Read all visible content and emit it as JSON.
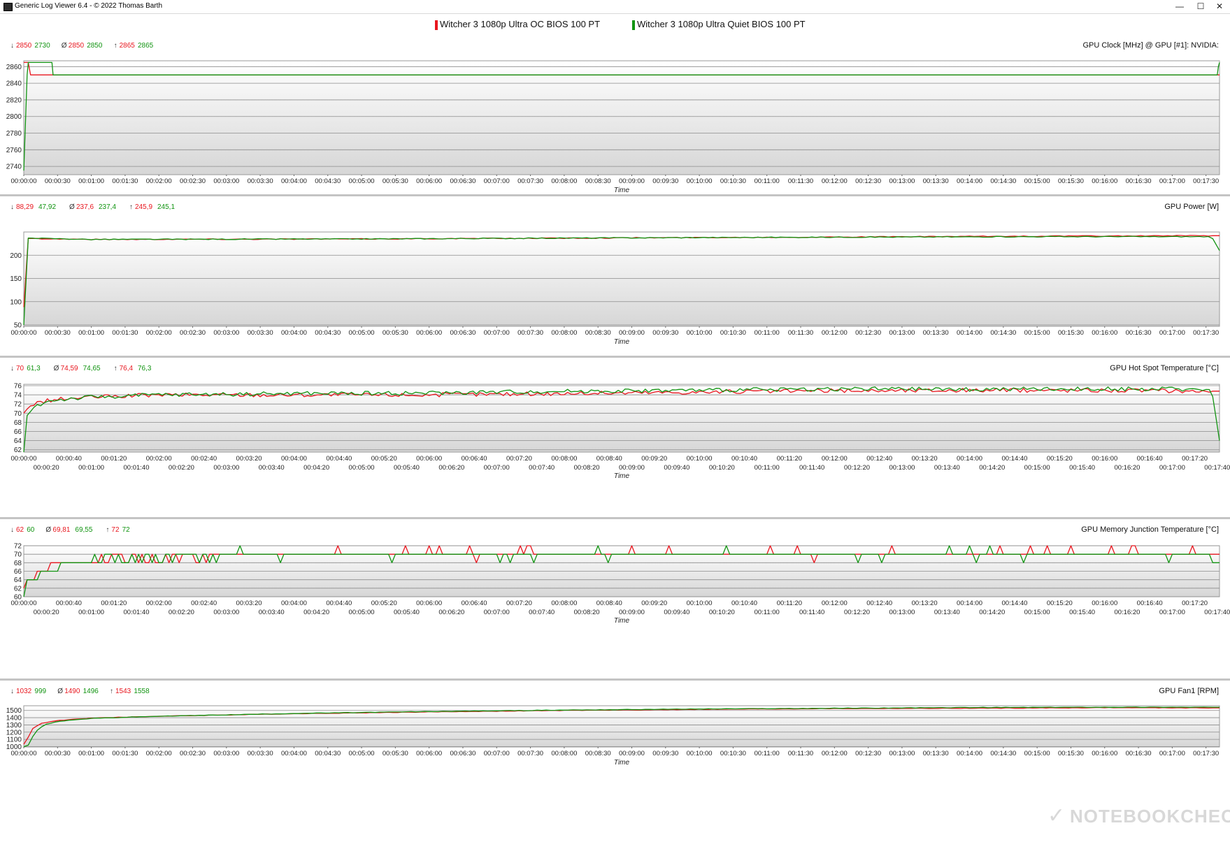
{
  "window": {
    "title": "Generic Log Viewer 6.4 - © 2022 Thomas Barth",
    "min_glyph": "—",
    "max_glyph": "☐",
    "close_glyph": "✕"
  },
  "colors": {
    "red": "#e8161e",
    "green": "#119411"
  },
  "legend": [
    {
      "label": "Witcher 3 1080p Ultra OC BIOS 100 PT",
      "color": "#e8161e"
    },
    {
      "label": "Witcher 3 1080p Ultra Quiet BIOS 100 PT",
      "color": "#119411"
    }
  ],
  "watermark": "NOTEBOOKCHECK",
  "chart_data": [
    {
      "type": "line",
      "title": "GPU Clock [MHz] @ GPU [#1]: NVIDIA:",
      "xlabel": "Time",
      "stats": {
        "min": [
          "2850",
          "2730"
        ],
        "avg": [
          "2850",
          "2850"
        ],
        "max": [
          "2865",
          "2865"
        ]
      },
      "ylim": [
        2730,
        2867
      ],
      "yticks": [
        2740,
        2760,
        2780,
        2800,
        2820,
        2840,
        2860
      ],
      "xticks_single": [
        "00:00:00",
        "00:00:30",
        "00:01:00",
        "00:01:30",
        "00:02:00",
        "00:02:30",
        "00:03:00",
        "00:03:30",
        "00:04:00",
        "00:04:30",
        "00:05:00",
        "00:05:30",
        "00:06:00",
        "00:06:30",
        "00:07:00",
        "00:07:30",
        "00:08:00",
        "00:08:30",
        "00:09:00",
        "00:09:30",
        "00:10:00",
        "00:10:30",
        "00:11:00",
        "00:11:30",
        "00:12:00",
        "00:12:30",
        "00:13:00",
        "00:13:30",
        "00:14:00",
        "00:14:30",
        "00:15:00",
        "00:15:30",
        "00:16:00",
        "00:16:30",
        "00:17:00",
        "00:17:30"
      ],
      "series": [
        {
          "name": "Witcher 3 1080p Ultra OC BIOS 100 PT",
          "x": [
            0,
            4,
            6,
            1060,
            1062,
            1062
          ],
          "y": [
            2865,
            2865,
            2850,
            2850,
            2850,
            2850
          ]
        },
        {
          "name": "Witcher 3 1080p Ultra Quiet BIOS 100 PT",
          "x": [
            0,
            3,
            4,
            25,
            26,
            1060,
            1061,
            1062
          ],
          "y": [
            2735,
            2850,
            2865,
            2865,
            2850,
            2850,
            2860,
            2865
          ]
        }
      ]
    },
    {
      "type": "line",
      "title": "GPU Power [W]",
      "xlabel": "Time",
      "stats": {
        "min": [
          "88,29",
          "47,92"
        ],
        "avg": [
          "237,6",
          "237,4"
        ],
        "max": [
          "245,9",
          "245,1"
        ]
      },
      "ylim": [
        47,
        250
      ],
      "yticks": [
        50,
        100,
        150,
        200
      ],
      "xticks_single": [
        "00:00:00",
        "00:00:30",
        "00:01:00",
        "00:01:30",
        "00:02:00",
        "00:02:30",
        "00:03:00",
        "00:03:30",
        "00:04:00",
        "00:04:30",
        "00:05:00",
        "00:05:30",
        "00:06:00",
        "00:06:30",
        "00:07:00",
        "00:07:30",
        "00:08:00",
        "00:08:30",
        "00:09:00",
        "00:09:30",
        "00:10:00",
        "00:10:30",
        "00:11:00",
        "00:11:30",
        "00:12:00",
        "00:12:30",
        "00:13:00",
        "00:13:30",
        "00:14:00",
        "00:14:30",
        "00:15:00",
        "00:15:30",
        "00:16:00",
        "00:16:30",
        "00:17:00",
        "00:17:30"
      ],
      "series": [
        {
          "name": "Witcher 3 1080p Ultra OC BIOS 100 PT",
          "x": [
            0,
            3,
            60,
            300,
            600,
            900,
            1062
          ],
          "y": [
            88.3,
            236,
            234,
            235,
            238,
            241,
            242
          ]
        },
        {
          "name": "Witcher 3 1080p Ultra Quiet BIOS 100 PT",
          "x": [
            0,
            3,
            60,
            300,
            600,
            900,
            1055,
            1062
          ],
          "y": [
            50,
            237,
            234,
            235,
            238,
            240,
            240,
            210
          ]
        }
      ]
    },
    {
      "type": "line",
      "title": "GPU Hot Spot Temperature [°C]",
      "xlabel": "Time",
      "stats": {
        "min": [
          "70",
          "61,3"
        ],
        "avg": [
          "74,59",
          "74,65"
        ],
        "max": [
          "76,4",
          "76,3"
        ]
      },
      "ylim": [
        61.5,
        76.3
      ],
      "yticks": [
        62,
        64,
        66,
        68,
        70,
        72,
        74,
        76
      ],
      "xticks_top": [
        "00:00:00",
        "00:00:40",
        "00:01:20",
        "00:02:00",
        "00:02:40",
        "00:03:20",
        "00:04:00",
        "00:04:40",
        "00:05:20",
        "00:06:00",
        "00:06:40",
        "00:07:20",
        "00:08:00",
        "00:08:40",
        "00:09:20",
        "00:10:00",
        "00:10:40",
        "00:11:20",
        "00:12:00",
        "00:12:40",
        "00:13:20",
        "00:14:00",
        "00:14:40",
        "00:15:20",
        "00:16:00",
        "00:16:40",
        "00:17:20"
      ],
      "xticks_bottom": [
        "00:00:20",
        "00:01:00",
        "00:01:40",
        "00:02:20",
        "00:03:00",
        "00:03:40",
        "00:04:20",
        "00:05:00",
        "00:05:40",
        "00:06:20",
        "00:07:00",
        "00:07:40",
        "00:08:20",
        "00:09:00",
        "00:09:40",
        "00:10:20",
        "00:11:00",
        "00:11:40",
        "00:12:20",
        "00:13:00",
        "00:13:40",
        "00:14:20",
        "00:15:00",
        "00:15:40",
        "00:16:20",
        "00:17:00",
        "00:17:40"
      ],
      "series": [
        {
          "name": "Witcher 3 1080p Ultra OC BIOS 100 PT",
          "x": [
            0,
            5,
            15,
            30,
            60,
            120,
            240,
            360,
            480,
            600,
            720,
            840,
            960,
            1062
          ],
          "y": [
            70,
            71.5,
            72.5,
            73,
            73.5,
            74,
            74,
            74,
            74.3,
            74.6,
            74.9,
            75,
            75,
            74.8
          ]
        },
        {
          "name": "Witcher 3 1080p Ultra Quiet BIOS 100 PT",
          "x": [
            0,
            3,
            10,
            25,
            60,
            120,
            240,
            360,
            480,
            600,
            720,
            840,
            960,
            1055,
            1062
          ],
          "y": [
            61.5,
            69.5,
            71.5,
            72.8,
            73.5,
            74,
            74.3,
            74.4,
            74.8,
            75,
            75.3,
            75.2,
            75.3,
            75.2,
            64
          ]
        }
      ]
    },
    {
      "type": "line",
      "title": "GPU Memory Junction Temperature [°C]",
      "xlabel": "Time",
      "stats": {
        "min": [
          "62",
          "60"
        ],
        "avg": [
          "69,81",
          "69,55"
        ],
        "max": [
          "72",
          "72"
        ]
      },
      "ylim": [
        60,
        72
      ],
      "yticks": [
        60,
        62,
        64,
        66,
        68,
        70,
        72
      ],
      "xticks_top": [
        "00:00:00",
        "00:00:40",
        "00:01:20",
        "00:02:00",
        "00:02:40",
        "00:03:20",
        "00:04:00",
        "00:04:40",
        "00:05:20",
        "00:06:00",
        "00:06:40",
        "00:07:20",
        "00:08:00",
        "00:08:40",
        "00:09:20",
        "00:10:00",
        "00:10:40",
        "00:11:20",
        "00:12:00",
        "00:12:40",
        "00:13:20",
        "00:14:00",
        "00:14:40",
        "00:15:20",
        "00:16:00",
        "00:16:40",
        "00:17:20"
      ],
      "xticks_bottom": [
        "00:00:20",
        "00:01:00",
        "00:01:40",
        "00:02:20",
        "00:03:00",
        "00:03:40",
        "00:04:20",
        "00:05:00",
        "00:05:40",
        "00:06:20",
        "00:07:00",
        "00:07:40",
        "00:08:20",
        "00:09:00",
        "00:09:40",
        "00:10:20",
        "00:11:00",
        "00:11:40",
        "00:12:20",
        "00:13:00",
        "00:13:40",
        "00:14:20",
        "00:15:00",
        "00:15:40",
        "00:16:20",
        "00:17:00",
        "00:17:40"
      ],
      "series": [
        {
          "name": "Witcher 3 1080p Ultra OC BIOS 100 PT",
          "x": [
            0,
            2,
            3,
            10,
            11,
            22,
            23,
            33,
            34,
            80,
            81,
            160,
            161,
            1062
          ],
          "y": [
            62,
            62,
            64,
            64,
            66,
            66,
            68,
            68,
            68,
            68,
            70,
            70,
            70,
            70
          ]
        },
        {
          "name": "Witcher 3 1080p Ultra Quiet BIOS 100 PT",
          "x": [
            0,
            4,
            5,
            12,
            13,
            25,
            26,
            40,
            41,
            90,
            91,
            170,
            171,
            1062
          ],
          "y": [
            60,
            64,
            64,
            64,
            66,
            66,
            66,
            68,
            68,
            68,
            70,
            70,
            70,
            70
          ]
        }
      ]
    },
    {
      "type": "line",
      "title": "GPU Fan1 [RPM]",
      "xlabel": "Time",
      "stats": {
        "min": [
          "1032",
          "999"
        ],
        "avg": [
          "1490",
          "1496"
        ],
        "max": [
          "1543",
          "1558"
        ]
      },
      "ylim": [
        995,
        1565
      ],
      "yticks": [
        1000,
        1100,
        1200,
        1300,
        1400,
        1500
      ],
      "xticks_single": [
        "00:00:00",
        "00:00:30",
        "00:01:00",
        "00:01:30",
        "00:02:00",
        "00:02:30",
        "00:03:00",
        "00:03:30",
        "00:04:00",
        "00:04:30",
        "00:05:00",
        "00:05:30",
        "00:06:00",
        "00:06:30",
        "00:07:00",
        "00:07:30",
        "00:08:00",
        "00:08:30",
        "00:09:00",
        "00:09:30",
        "00:10:00",
        "00:10:30",
        "00:11:00",
        "00:11:30",
        "00:12:00",
        "00:12:30",
        "00:13:00",
        "00:13:30",
        "00:14:00",
        "00:14:30",
        "00:15:00",
        "00:15:30",
        "00:16:00",
        "00:16:30",
        "00:17:00",
        "00:17:30"
      ],
      "series": [
        {
          "name": "Witcher 3 1080p Ultra OC BIOS 100 PT",
          "x": [
            0,
            3,
            8,
            15,
            30,
            60,
            120,
            240,
            360,
            480,
            600,
            720,
            840,
            960,
            1062
          ],
          "y": [
            1032,
            1100,
            1250,
            1320,
            1360,
            1395,
            1420,
            1455,
            1480,
            1500,
            1515,
            1525,
            1530,
            1538,
            1535
          ]
        },
        {
          "name": "Witcher 3 1080p Ultra Quiet BIOS 100 PT",
          "x": [
            0,
            4,
            10,
            18,
            30,
            60,
            120,
            240,
            360,
            480,
            600,
            720,
            840,
            960,
            1062
          ],
          "y": [
            999,
            1020,
            1200,
            1300,
            1350,
            1390,
            1420,
            1458,
            1485,
            1505,
            1520,
            1530,
            1540,
            1545,
            1545
          ]
        }
      ]
    }
  ]
}
